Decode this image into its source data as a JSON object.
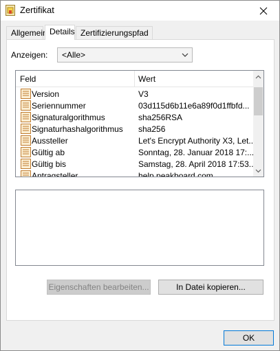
{
  "window": {
    "title": "Zertifikat",
    "icon": "certificate-icon",
    "close_icon": "close-icon"
  },
  "tabs": [
    {
      "label": "Allgemein",
      "active": false
    },
    {
      "label": "Details",
      "active": true
    },
    {
      "label": "Zertifizierungspfad",
      "active": false
    }
  ],
  "filter": {
    "label": "Anzeigen:",
    "selected": "<Alle>"
  },
  "table": {
    "columns": [
      "Feld",
      "Wert"
    ],
    "rows": [
      {
        "field": "Version",
        "value": "V3"
      },
      {
        "field": "Seriennummer",
        "value": "03d115d6b11e6a89f0d1ffbfd..."
      },
      {
        "field": "Signaturalgorithmus",
        "value": "sha256RSA"
      },
      {
        "field": "Signaturhashalgorithmus",
        "value": "sha256"
      },
      {
        "field": "Aussteller",
        "value": "Let's Encrypt Authority X3, Let..."
      },
      {
        "field": "Gültig ab",
        "value": "Sonntag, 28. Januar 2018 17:..."
      },
      {
        "field": "Gültig bis",
        "value": "Samstag, 28. April 2018 17:53..."
      },
      {
        "field": "Antragsteller",
        "value": "help.peakboard.com"
      }
    ]
  },
  "buttons": {
    "edit": "Eigenschaften bearbeiten...",
    "copy": "In Datei kopieren...",
    "ok": "OK"
  },
  "colors": {
    "accent": "#0078d7",
    "window_bg": "#f0f0f0",
    "disabled_text": "#838383"
  }
}
